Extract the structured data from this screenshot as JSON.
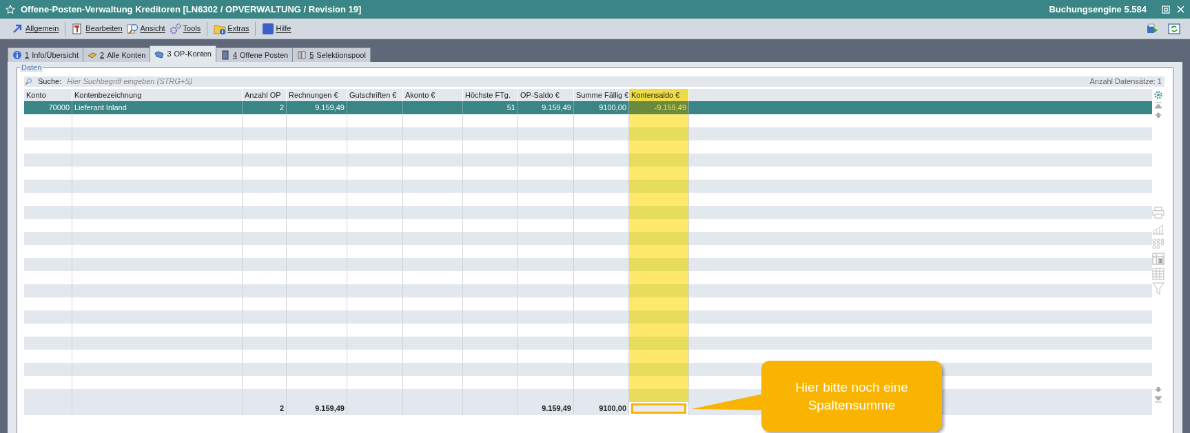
{
  "window": {
    "title": "Offene-Posten-Verwaltung Kreditoren [LN6302 / OPVERWALTUNG / Revision 19]",
    "app_version": "Buchungsengine 5.584"
  },
  "toolbar": [
    {
      "label": "Allgemein"
    },
    {
      "label": "Bearbeiten"
    },
    {
      "label": "Ansicht"
    },
    {
      "label": "Tools"
    },
    {
      "label": "Extras"
    },
    {
      "label": "Hilfe"
    }
  ],
  "tabs": [
    {
      "number": "1",
      "label": "Info/Übersicht",
      "selected": false
    },
    {
      "number": "2",
      "label": "Alle Konten",
      "selected": false
    },
    {
      "number": "3",
      "label": "OP-Konten",
      "selected": true
    },
    {
      "number": "4",
      "label": "Offene Posten",
      "selected": false
    },
    {
      "number": "5",
      "label": "Selektionspool",
      "selected": false
    }
  ],
  "group_label": "Daten",
  "search": {
    "label": "Suche:",
    "placeholder": "Hier Suchbegriff eingeben (STRG+S)"
  },
  "record_count": "Anzahl Datensätze: 1",
  "table": {
    "columns": [
      {
        "label": "Konto",
        "highlighted": false
      },
      {
        "label": "Kontenbezeichnung",
        "highlighted": false
      },
      {
        "label": "Anzahl OP",
        "highlighted": false,
        "total": "2"
      },
      {
        "label": "Rechnungen €",
        "highlighted": false,
        "total": "9.159,49"
      },
      {
        "label": "Gutschriften €",
        "highlighted": false
      },
      {
        "label": "Akonto €",
        "highlighted": false
      },
      {
        "label": "Höchste FTg.",
        "highlighted": false
      },
      {
        "label": "OP-Saldo €",
        "highlighted": false,
        "total": "9.159,49"
      },
      {
        "label": "Summe Fällig €",
        "highlighted": false,
        "total": "9100,00"
      },
      {
        "label": "Kontensaldo €",
        "highlighted": true
      }
    ],
    "rows": [
      {
        "selected": true,
        "cells": [
          "70000",
          "Lieferant Inland",
          "2",
          "9.159,49",
          null,
          null,
          "51",
          "9.159,49",
          "9100,00",
          "-9.159,49"
        ]
      }
    ]
  },
  "callout": {
    "text": "Hier bitte noch eine Spaltensumme"
  }
}
